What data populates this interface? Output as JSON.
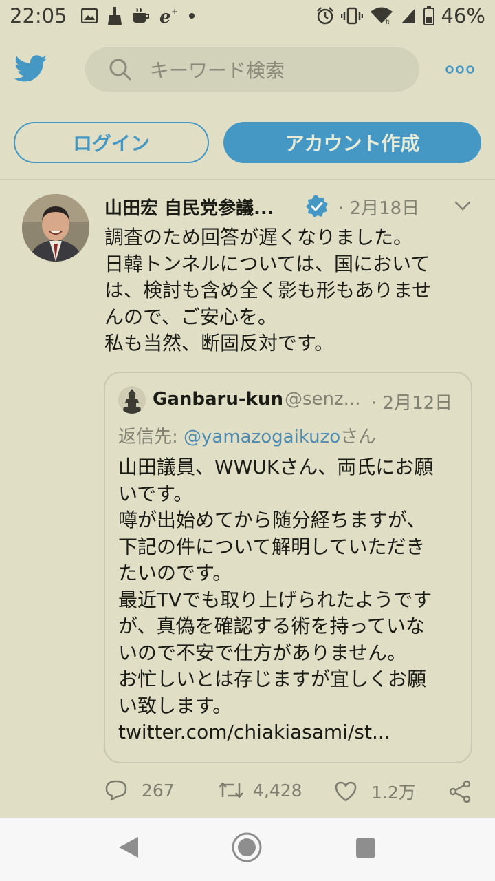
{
  "status_bar": {
    "time": "22:05",
    "battery_percent": "46%",
    "left_icons": [
      "image-icon",
      "broom-icon",
      "cup-icon",
      "e-plus-icon",
      "dot-icon"
    ],
    "right_icons": [
      "alarm-icon",
      "vibrate-icon",
      "wifi-icon",
      "signal-icon",
      "battery-icon"
    ]
  },
  "header": {
    "search_placeholder": "キーワード検索",
    "login_label": "ログイン",
    "signup_label": "アカウント作成"
  },
  "tweet": {
    "author_name": "山田宏 自民党参議...",
    "date": "· 2月18日",
    "body_lines": [
      "調査のため回答が遅くなりました。",
      "日韓トンネルについては、国において",
      "は、検討も含め全く影も形もありませ",
      "んので、ご安心を。",
      "私も当然、断固反対です。"
    ],
    "quote": {
      "author_name": "Ganbaru-kun",
      "handle": "@senz...",
      "date": "· 2月12日",
      "reply_prefix": "返信先: ",
      "reply_mention": "@yamazogaikuzo",
      "reply_suffix": "さん",
      "body_lines": [
        "山田議員、WWUKさん、両氏にお願",
        "いです。",
        "噂が出始めてから随分経ちますが、",
        "下記の件について解明していただき",
        "たいのです。",
        "最近TVでも取り上げられたようです",
        "が、真偽を確認する術を持っていな",
        "いので不安で仕方がありません。",
        "お忙しいとは存じますが宜しくお願",
        "い致します。",
        "twitter.com/chiakiasami/st..."
      ]
    },
    "actions": {
      "replies": "267",
      "retweets": "4,428",
      "likes": "1.2万"
    }
  },
  "colors": {
    "background": "#e0dfc6",
    "accent": "#4597c4",
    "muted_text": "#828172",
    "navbar": "#f7f7f7"
  }
}
